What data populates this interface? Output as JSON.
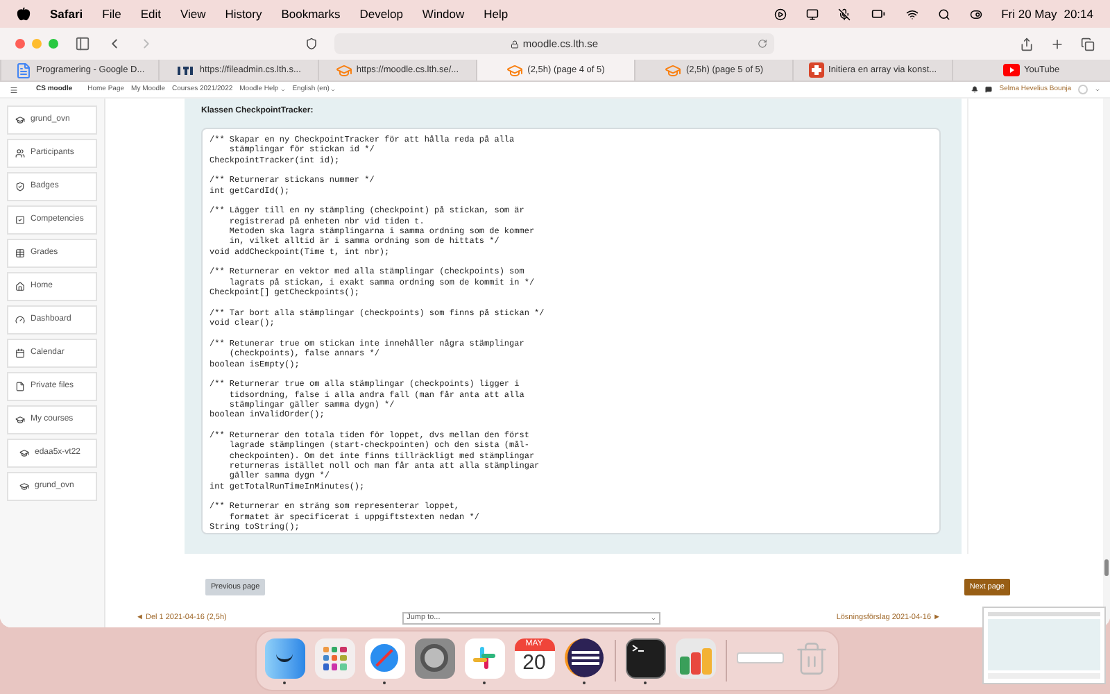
{
  "menubar": {
    "app": "Safari",
    "menus": [
      "File",
      "Edit",
      "View",
      "History",
      "Bookmarks",
      "Develop",
      "Window",
      "Help"
    ],
    "date": "Fri 20 May",
    "time": "20:14"
  },
  "toolbar": {
    "url": "moodle.cs.lth.se"
  },
  "tabs": [
    {
      "label": "Programering - Google D...",
      "selected": false,
      "kind": "doc"
    },
    {
      "label": "https://fileadmin.cs.lth.s...",
      "selected": false,
      "kind": "lth"
    },
    {
      "label": "https://moodle.cs.lth.se/...",
      "selected": false,
      "kind": "moodle"
    },
    {
      "label": "(2,5h) (page 4 of 5)",
      "selected": true,
      "kind": "moodle"
    },
    {
      "label": "(2,5h) (page 5 of 5)",
      "selected": false,
      "kind": "moodle"
    },
    {
      "label": "Initiera en array via konst...",
      "selected": false,
      "kind": "cross"
    },
    {
      "label": "YouTube",
      "selected": false,
      "kind": "youtube"
    }
  ],
  "moodle_nav": {
    "brand": "CS moodle",
    "links": [
      {
        "label": "Home Page",
        "dropdown": false
      },
      {
        "label": "My Moodle",
        "dropdown": false
      },
      {
        "label": "Courses 2021/2022",
        "dropdown": false
      },
      {
        "label": "Moodle Help",
        "dropdown": true
      },
      {
        "label": "English (en)",
        "dropdown": true
      }
    ],
    "user": "Selma Hevelius Bounja"
  },
  "sidebar": {
    "sections": [
      [
        {
          "label": "grund_ovn",
          "kind": "course"
        },
        {
          "label": "Participants",
          "kind": "users"
        },
        {
          "label": "Badges",
          "kind": "shield"
        },
        {
          "label": "Competencies",
          "kind": "check"
        },
        {
          "label": "Grades",
          "kind": "table"
        }
      ],
      [
        {
          "label": "Home",
          "kind": "home"
        },
        {
          "label": "Dashboard",
          "kind": "gauge"
        },
        {
          "label": "Calendar",
          "kind": "calendar"
        },
        {
          "label": "Private files",
          "kind": "file"
        },
        {
          "label": "My courses",
          "kind": "course",
          "children": [
            {
              "label": "edaa5x-vt22",
              "kind": "course"
            },
            {
              "label": "grund_ovn",
              "kind": "course"
            }
          ]
        }
      ]
    ]
  },
  "content": {
    "heading": "Klassen CheckpointTracker:",
    "code": "/** Skapar en ny CheckpointTracker för att hålla reda på alla\n    stämplingar för stickan id */\nCheckpointTracker(int id);\n\n/** Returnerar stickans nummer */\nint getCardId();\n\n/** Lägger till en ny stämpling (checkpoint) på stickan, som är\n    registrerad på enheten nbr vid tiden t.\n    Metoden ska lagra stämplingarna i samma ordning som de kommer\n    in, vilket alltid är i samma ordning som de hittats */\nvoid addCheckpoint(Time t, int nbr);\n\n/** Returnerar en vektor med alla stämplingar (checkpoints) som\n    lagrats på stickan, i exakt samma ordning som de kommit in */\nCheckpoint[] getCheckpoints();\n\n/** Tar bort alla stämplingar (checkpoints) som finns på stickan */\nvoid clear();\n\n/** Retunerar true om stickan inte innehåller några stämplingar\n    (checkpoints), false annars */\nboolean isEmpty();\n\n/** Returnerar true om alla stämplingar (checkpoints) ligger i\n    tidsordning, false i alla andra fall (man får anta att alla\n    stämplingar gäller samma dygn) */\nboolean inValidOrder();\n\n/** Returnerar den totala tiden för loppet, dvs mellan den först\n    lagrade stämplingen (start-checkpointen) och den sista (mål-\n    checkpointen). Om det inte finns tillräckligt med stämplingar\n    returneras istället noll och man får anta att alla stämplingar\n    gäller samma dygn */\nint getTotalRunTimeInMinutes();\n\n/** Returnerar en sträng som representerar loppet,\n    formatet är specificerat i uppgiftstexten nedan */\nString toString();",
    "prev_button": "Previous page",
    "next_button": "Next page",
    "prev_link": "◄ Del 1 2021-04-16 (2,5h)",
    "jump": "Jump to...",
    "next_link": "Lösningsförslag 2021-04-16 ►"
  },
  "dock": [
    {
      "kind": "finder",
      "running": true
    },
    {
      "kind": "launchpad",
      "running": false
    },
    {
      "kind": "safari",
      "running": true
    },
    {
      "kind": "settings",
      "running": false
    },
    {
      "kind": "slack",
      "running": true
    },
    {
      "kind": "calendar",
      "running": false,
      "month": "MAY",
      "day": "20"
    },
    {
      "kind": "eclipse",
      "running": true
    },
    {
      "kind": "separator"
    },
    {
      "kind": "terminal",
      "running": true
    },
    {
      "kind": "stack",
      "running": false
    },
    {
      "kind": "separator"
    },
    {
      "kind": "window",
      "running": false
    },
    {
      "kind": "trash",
      "running": false
    }
  ]
}
